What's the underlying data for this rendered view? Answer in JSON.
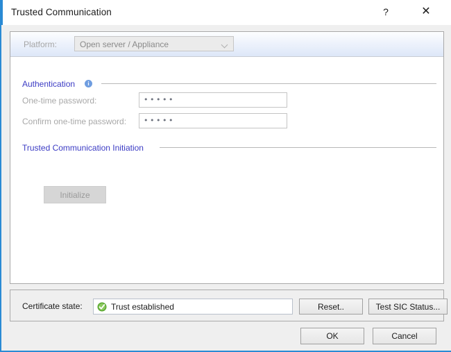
{
  "window": {
    "title": "Trusted Communication",
    "help_glyph": "?",
    "close_glyph": "✕",
    "accent_color": "#2a8ad4"
  },
  "platform": {
    "label": "Platform:",
    "selected": "Open server / Appliance",
    "options": [
      "Open server / Appliance"
    ]
  },
  "authentication": {
    "section_title": "Authentication",
    "info_glyph": "i",
    "one_time_password": {
      "label": "One-time password:",
      "value": "•••••"
    },
    "confirm_one_time_password": {
      "label": "Confirm one-time password:",
      "value": "•••••"
    }
  },
  "initiation": {
    "section_title": "Trusted Communication Initiation",
    "initialize_label": "Initialize"
  },
  "certificate": {
    "label": "Certificate state:",
    "state_text": "Trust established",
    "state_icon": "green-check-icon",
    "state_color": "#5aa832",
    "reset_label": "Reset..",
    "test_sic_label": "Test SIC Status..."
  },
  "footer": {
    "ok_label": "OK",
    "cancel_label": "Cancel"
  }
}
